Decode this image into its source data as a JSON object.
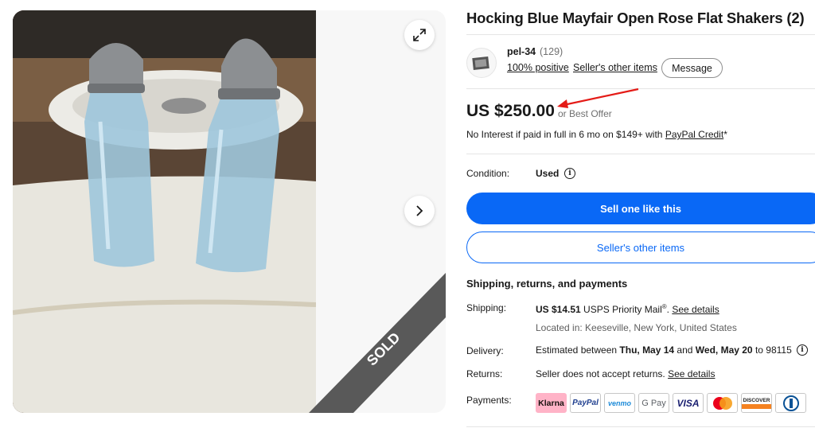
{
  "listing": {
    "title": "Hocking Blue Mayfair Open Rose Flat Shakers (2)"
  },
  "gallery": {
    "sold_label": "SOLD",
    "expand_icon": "expand-icon",
    "next_icon": "chevron-right-icon"
  },
  "seller": {
    "name": "pel-34",
    "feedback_count": "(129)",
    "positive": "100% positive",
    "separator": "·",
    "other_items_link": "Seller's other items",
    "message_button": "Message"
  },
  "price": {
    "amount": "US $250.00",
    "best_offer": "or Best Offer",
    "financing_text": "No Interest if paid in full in 6 mo on $149+ with ",
    "financing_link": "PayPal Credit",
    "financing_suffix": "*"
  },
  "condition": {
    "label": "Condition:",
    "value": "Used",
    "info_glyph": "i"
  },
  "actions": {
    "primary_button": "Sell one like this",
    "secondary_button": "Seller's other items"
  },
  "shipping_section": {
    "heading": "Shipping, returns, and payments",
    "shipping_label": "Shipping:",
    "shipping_price": "US $14.51",
    "shipping_service": " USPS Priority Mail",
    "shipping_reg": "®",
    "shipping_link": "See details",
    "location": "Located in: Keeseville, New York, United States",
    "delivery_label": "Delivery:",
    "delivery_prefix": "Estimated between ",
    "delivery_start": "Thu, May 14",
    "delivery_and": " and ",
    "delivery_end": "Wed, May 20",
    "delivery_to": " to 98115",
    "returns_label": "Returns:",
    "returns_text": "Seller does not accept returns. ",
    "returns_link": "See details",
    "payments_label": "Payments:"
  },
  "payment_methods": {
    "klarna": "Klarna",
    "paypal": "PayPal",
    "venmo": "venmo",
    "gpay": "G Pay",
    "visa": "VISA",
    "mastercard": "mastercard-logo",
    "discover": "DISCOVER",
    "diners": "diners-club-logo"
  },
  "colors": {
    "accent_blue": "#0968f6",
    "klarna_pink": "#ffb3c7",
    "annotation_red": "#e41b17"
  }
}
